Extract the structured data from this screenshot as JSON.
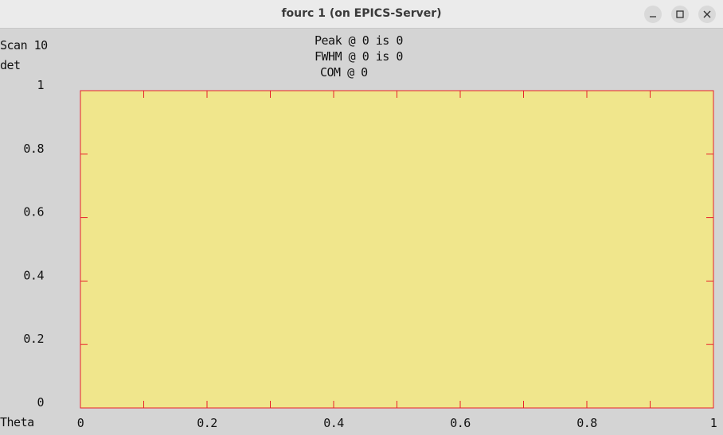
{
  "window": {
    "title": "fourc 1 (on EPICS-Server)",
    "controls": {
      "minimize_icon": "minimize-icon",
      "maximize_icon": "maximize-icon",
      "close_icon": "close-icon"
    }
  },
  "chart_data": {
    "type": "line",
    "scan_label": "Scan 10",
    "ylabel": "det",
    "xlabel": "Theta",
    "stats": {
      "peak": "Peak @ 0 is 0",
      "fwhm": "FWHM @ 0 is 0",
      "com": "COM @ 0"
    },
    "xlim": [
      0,
      1
    ],
    "ylim": [
      0,
      1
    ],
    "x_ticks": [
      "0",
      "0.2",
      "0.4",
      "0.6",
      "0.8",
      "1"
    ],
    "y_ticks": [
      "0",
      "0.2",
      "0.4",
      "0.6",
      "0.8",
      "1"
    ],
    "series": [
      {
        "x": [],
        "values": []
      }
    ],
    "colors": {
      "plot_background": "#f0e68c",
      "frame": "#e8202a",
      "outer_background": "#d4d4d4"
    }
  }
}
